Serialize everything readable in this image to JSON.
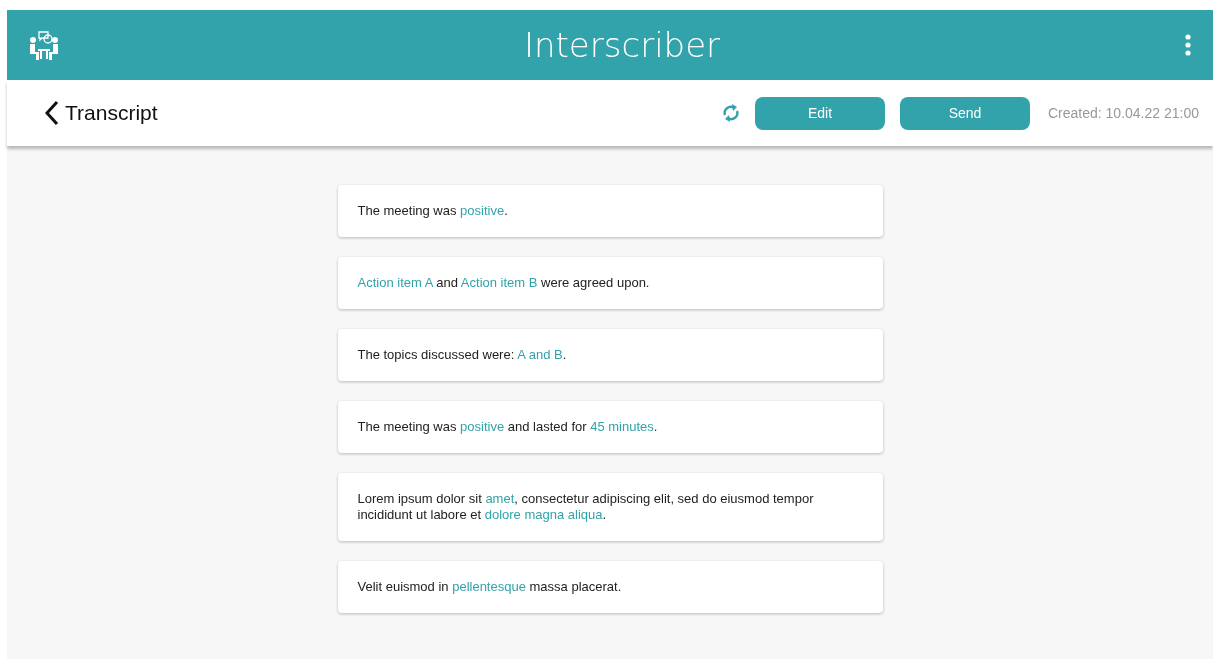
{
  "app_bar": {
    "title": "Interscriber"
  },
  "toolbar": {
    "title": "Transcript",
    "buttons": [
      "Edit",
      "Send"
    ],
    "created": "Created: 10.04.22 21:00"
  },
  "statements": [
    {
      "segments": [
        {
          "text": "The meeting was ",
          "highlighted": false
        },
        {
          "text": "positive",
          "highlighted": true
        },
        {
          "text": ".",
          "highlighted": false
        }
      ]
    },
    {
      "segments": [
        {
          "text": "Action item A",
          "highlighted": true
        },
        {
          "text": " and ",
          "highlighted": false
        },
        {
          "text": "Action item B",
          "highlighted": true
        },
        {
          "text": " were agreed upon.",
          "highlighted": false
        }
      ]
    },
    {
      "segments": [
        {
          "text": "The topics discussed were: ",
          "highlighted": false
        },
        {
          "text": "A and B",
          "highlighted": true
        },
        {
          "text": ".",
          "highlighted": false
        }
      ]
    },
    {
      "segments": [
        {
          "text": "The meeting was ",
          "highlighted": false
        },
        {
          "text": "positive",
          "highlighted": true
        },
        {
          "text": " and lasted for ",
          "highlighted": false
        },
        {
          "text": "45 minutes",
          "highlighted": true
        },
        {
          "text": ".",
          "highlighted": false
        }
      ]
    },
    {
      "segments": [
        {
          "text": "Lorem ipsum dolor sit ",
          "highlighted": false
        },
        {
          "text": "amet",
          "highlighted": true
        },
        {
          "text": ", consectetur adipiscing elit, sed do eiusmod tempor incididunt ut labore et ",
          "highlighted": false
        },
        {
          "text": "dolore magna aliqua",
          "highlighted": true
        },
        {
          "text": ".",
          "highlighted": false
        }
      ]
    },
    {
      "segments": [
        {
          "text": "Velit euismod in ",
          "highlighted": false
        },
        {
          "text": "pellentesque",
          "highlighted": true
        },
        {
          "text": " massa placerat.",
          "highlighted": false
        }
      ]
    }
  ]
}
